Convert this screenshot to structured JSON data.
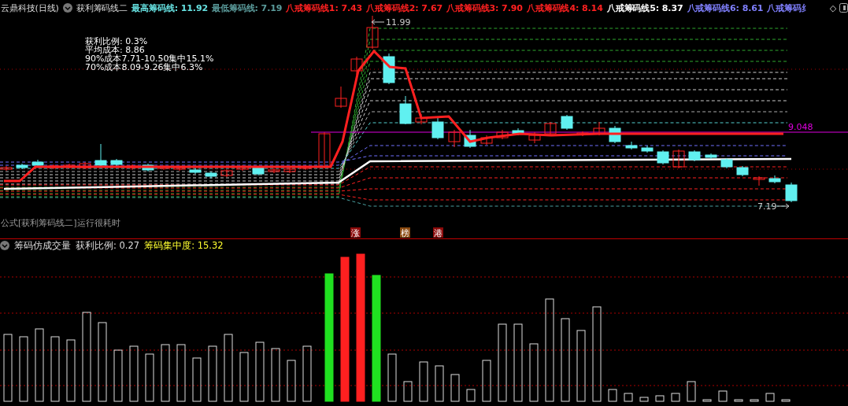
{
  "header": {
    "stock_title": "云鼎科技(日线)",
    "indicator_name": "获利筹码线二",
    "lines": [
      {
        "label": "最高筹码线:",
        "value": "11.92",
        "color": "#66e0e0"
      },
      {
        "label": "最低筹码线:",
        "value": "7.19",
        "color": "#5a9a9a"
      },
      {
        "label": "八戒筹码线1:",
        "value": "7.43",
        "color": "#ff2020"
      },
      {
        "label": "八戒筹码线2:",
        "value": "7.67",
        "color": "#ff2020"
      },
      {
        "label": "八戒筹码线3:",
        "value": "7.90",
        "color": "#ff2020"
      },
      {
        "label": "八戒筹码线4:",
        "value": "8.14",
        "color": "#ff2020"
      },
      {
        "label": "八戒筹码线5:",
        "value": "8.37",
        "color": "#ffffff"
      },
      {
        "label": "八戒筹码线6:",
        "value": "8.61",
        "color": "#8080ff"
      },
      {
        "label": "八戒筹码纟",
        "color": "#8080ff"
      }
    ],
    "more": "◇"
  },
  "main_chart": {
    "stats": [
      "获利比例: 0.3%",
      "平均成本: 8.86",
      "90%成本7.71-10.50集中15.1%",
      "70%成本8.09-9.26集中6.3%"
    ],
    "high_label": "11.99",
    "low_label": "7.19",
    "line_label": "9.048",
    "notice": "公式[获利筹码线二]运行很耗时",
    "tags": [
      {
        "text": "涨",
        "color": "#8b0a0a"
      },
      {
        "text": "榜",
        "color": "#8b4a10"
      },
      {
        "text": "港",
        "color": "#8b0a0a"
      }
    ]
  },
  "sub_chart": {
    "name": "筹码仿成交量",
    "profit_ratio": "获利比例: 0.27",
    "concentration": "筹码集中度: 15.32"
  }
}
